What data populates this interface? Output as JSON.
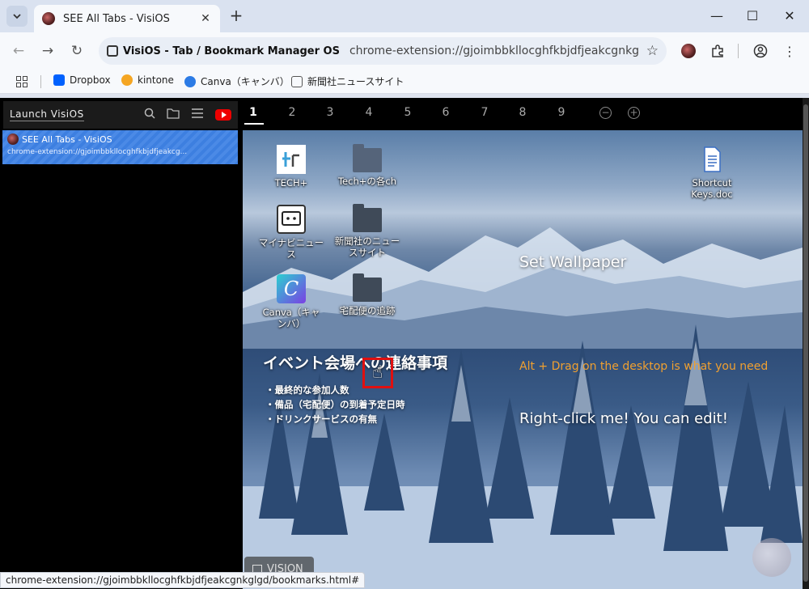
{
  "browser": {
    "tab_title": "SEE All Tabs - VisiOS",
    "new_tab_glyph": "+",
    "window_controls": {
      "minimize": "—",
      "maximize": "☐",
      "close": "✕"
    },
    "omnibox": {
      "site_chip": "VisiOS - Tab / Bookmark Manager OS",
      "url": "chrome-extension://gjoimbbkllocghfkbjdfjeakcgnkglgd/bookma..."
    },
    "bookmarks": [
      {
        "label": "Dropbox",
        "color": "#0061fe"
      },
      {
        "label": "kintone",
        "color": "#f5a623"
      },
      {
        "label": "Canva（キャンバ）",
        "color": "#2c7be5"
      },
      {
        "label": "新聞社ニュースサイト",
        "color": "#555555"
      }
    ],
    "status_url": "chrome-extension://gjoimbbkllocghfkbjdfjeakcgnkglgd/bookmarks.html#"
  },
  "sidebar": {
    "launch_label": "Launch VisiOS",
    "item": {
      "title": "SEE All Tabs - VisiOS",
      "url": "chrome-extension://gjoimbbkllocghfkbjdfjeakcg..."
    }
  },
  "desktop_tabs": {
    "items": [
      "1",
      "2",
      "3",
      "4",
      "5",
      "6",
      "7",
      "8",
      "9"
    ],
    "active": "1",
    "zoom_out": "−",
    "zoom_in": "+"
  },
  "desktop": {
    "icons": {
      "tech_plus": "TECH+",
      "tech_folder": "Tech+の各ch",
      "shortcut_doc": "Shortcut Keys.doc",
      "mynavi": "マイナビニュース",
      "news_folder": "新聞社のニュースサイト",
      "canva": "Canva（キャンバ）",
      "delivery_folder": "宅配便の追跡"
    },
    "notice": {
      "title": "イベント会場への連絡事項",
      "items": [
        "・最終的な参加人数",
        "・備品（宅配便）の到着予定日時",
        "・ドリンクサービスの有無"
      ]
    },
    "set_wallpaper": "Set Wallpaper",
    "alt_drag": "Alt + Drag on the desktop is what you need",
    "right_click": "Right-click me! You can edit!",
    "vision_button": "VISION"
  }
}
